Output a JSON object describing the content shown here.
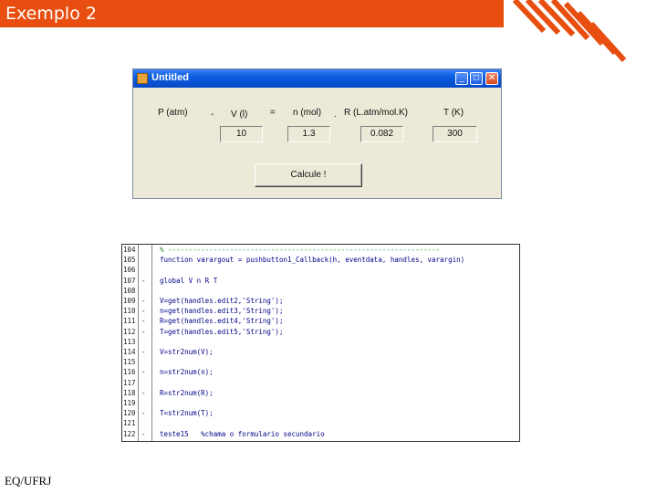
{
  "slide": {
    "title": "Exemplo 2",
    "footer": "EQ/UFRJ",
    "accent_color": "#e84e0f"
  },
  "gui_window": {
    "title": "Untitled",
    "icon": "matlab-figure-icon",
    "controls": [
      "minimize-icon",
      "maximize-icon",
      "close-icon"
    ],
    "labels": {
      "p": "P (atm)",
      "times1": "-",
      "v": "V (l)",
      "equals": "=",
      "n": "n (mol)",
      "times2": ".",
      "r": "R (L.atm/mol.K)",
      "t": "T (K)"
    },
    "fields": {
      "v": "10",
      "n": "1.3",
      "r": "0.082",
      "t": "300"
    },
    "button": "Calcule !"
  },
  "editor": {
    "lines": [
      {
        "num": "104",
        "mark": "",
        "text": "% ------------------------------------------------------------------",
        "kind": "comment"
      },
      {
        "num": "105",
        "mark": "",
        "text": "function varargout = pushbutton1_Callback(h, eventdata, handles, varargin)",
        "kind": "code"
      },
      {
        "num": "106",
        "mark": "",
        "text": "",
        "kind": "code"
      },
      {
        "num": "107",
        "mark": "-",
        "text": "global V n R T",
        "kind": "code"
      },
      {
        "num": "108",
        "mark": "",
        "text": "",
        "kind": "code"
      },
      {
        "num": "109",
        "mark": "-",
        "text": "V=get(handles.edit2,'String');",
        "kind": "code"
      },
      {
        "num": "110",
        "mark": "-",
        "text": "n=get(handles.edit3,'String');",
        "kind": "code"
      },
      {
        "num": "111",
        "mark": "-",
        "text": "R=get(handles.edit4,'String');",
        "kind": "code"
      },
      {
        "num": "112",
        "mark": "-",
        "text": "T=get(handles.edit5,'String');",
        "kind": "code"
      },
      {
        "num": "113",
        "mark": "",
        "text": "",
        "kind": "code"
      },
      {
        "num": "114",
        "mark": "-",
        "text": "V=str2num(V);",
        "kind": "code"
      },
      {
        "num": "115",
        "mark": "",
        "text": "",
        "kind": "code"
      },
      {
        "num": "116",
        "mark": "-",
        "text": "n=str2num(n);",
        "kind": "code"
      },
      {
        "num": "117",
        "mark": "",
        "text": "",
        "kind": "code"
      },
      {
        "num": "118",
        "mark": "-",
        "text": "R=str2num(R);",
        "kind": "code"
      },
      {
        "num": "119",
        "mark": "",
        "text": "",
        "kind": "code"
      },
      {
        "num": "120",
        "mark": "-",
        "text": "T=str2num(T);",
        "kind": "code"
      },
      {
        "num": "121",
        "mark": "",
        "text": "",
        "kind": "code"
      },
      {
        "num": "122",
        "mark": "-",
        "text": "teste15   %chama o formulario secundario",
        "kind": "code"
      }
    ]
  }
}
